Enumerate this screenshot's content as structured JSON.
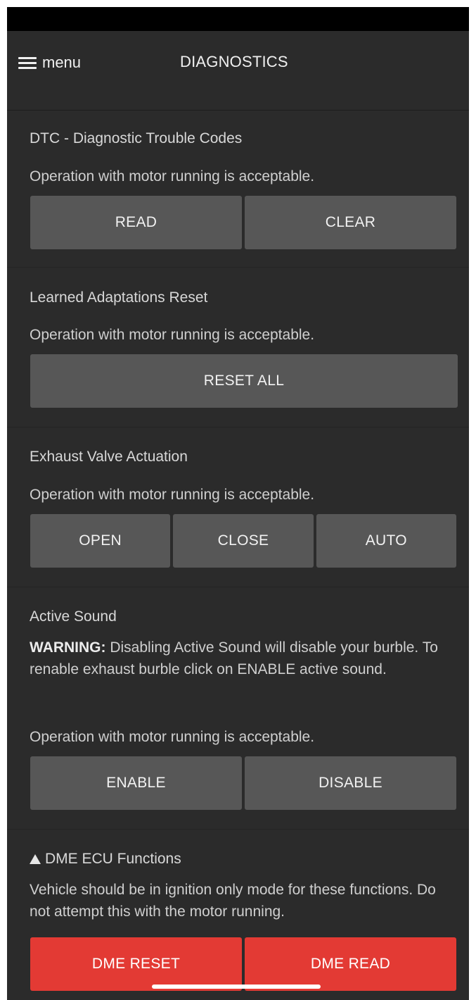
{
  "header": {
    "menu_label": "menu",
    "title": "DIAGNOSTICS",
    "menu_icon": "hamburger-icon"
  },
  "sections": {
    "dtc": {
      "title": "DTC - Diagnostic Trouble Codes",
      "note": "Operation with motor running is acceptable.",
      "buttons": [
        "READ",
        "CLEAR"
      ]
    },
    "adaptations": {
      "title": "Learned Adaptations Reset",
      "note": "Operation with motor running is acceptable.",
      "buttons": [
        "RESET ALL"
      ]
    },
    "exhaust": {
      "title": "Exhaust Valve Actuation",
      "note": "Operation with motor running is acceptable.",
      "buttons": [
        "OPEN",
        "CLOSE",
        "AUTO"
      ]
    },
    "active_sound": {
      "title": "Active Sound",
      "warning_label": "WARNING:",
      "warning_text": " Disabling Active Sound will disable your burble. To renable exhaust burble click on ENABLE active sound.",
      "note": "Operation with motor running is acceptable.",
      "buttons": [
        "ENABLE",
        "DISABLE"
      ]
    },
    "dme": {
      "title": "DME ECU Functions",
      "title_icon": "warning-triangle-icon",
      "note": "Vehicle should be in ignition only mode for these functions. Do not attempt this with the motor running.",
      "buttons": [
        "DME RESET",
        "DME READ"
      ]
    }
  },
  "colors": {
    "background": "#2b2b2b",
    "button": "#575757",
    "danger_button": "#e33a34",
    "text": "#e6e6e6"
  }
}
